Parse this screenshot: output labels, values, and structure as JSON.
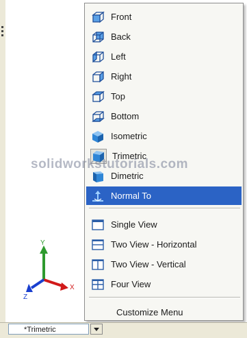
{
  "menu": {
    "standard_views": [
      {
        "label": "Front",
        "icon": "view-cube-front-icon"
      },
      {
        "label": "Back",
        "icon": "view-cube-back-icon"
      },
      {
        "label": "Left",
        "icon": "view-cube-left-icon"
      },
      {
        "label": "Right",
        "icon": "view-cube-right-icon"
      },
      {
        "label": "Top",
        "icon": "view-cube-top-icon"
      },
      {
        "label": "Bottom",
        "icon": "view-cube-bottom-icon"
      },
      {
        "label": "Isometric",
        "icon": "isometric-cube-icon"
      },
      {
        "label": "Trimetric",
        "icon": "trimetric-cube-icon"
      },
      {
        "label": "Dimetric",
        "icon": "dimetric-cube-icon"
      },
      {
        "label": "Normal To",
        "icon": "normal-to-icon",
        "highlighted": true
      }
    ],
    "viewport_layouts": [
      {
        "label": "Single View",
        "icon": "single-view-icon"
      },
      {
        "label": "Two View - Horizontal",
        "icon": "two-view-horizontal-icon"
      },
      {
        "label": "Two View - Vertical",
        "icon": "two-view-vertical-icon"
      },
      {
        "label": "Four View",
        "icon": "four-view-icon"
      }
    ],
    "customize": {
      "label": "Customize Menu"
    }
  },
  "watermark": "solidworkstutorials.com",
  "status_bar": {
    "current_view": "*Trimetric"
  },
  "triad": {
    "y_label": "Y",
    "x_label": "X",
    "z_label": "Z"
  },
  "colors": {
    "highlight": "#2b63c5",
    "menu_background": "#f7f7f3",
    "cube_blue": "#2f86d6",
    "axis_x": "#d11a1a",
    "axis_y": "#2e9a2e",
    "axis_z": "#1a3fcf"
  }
}
